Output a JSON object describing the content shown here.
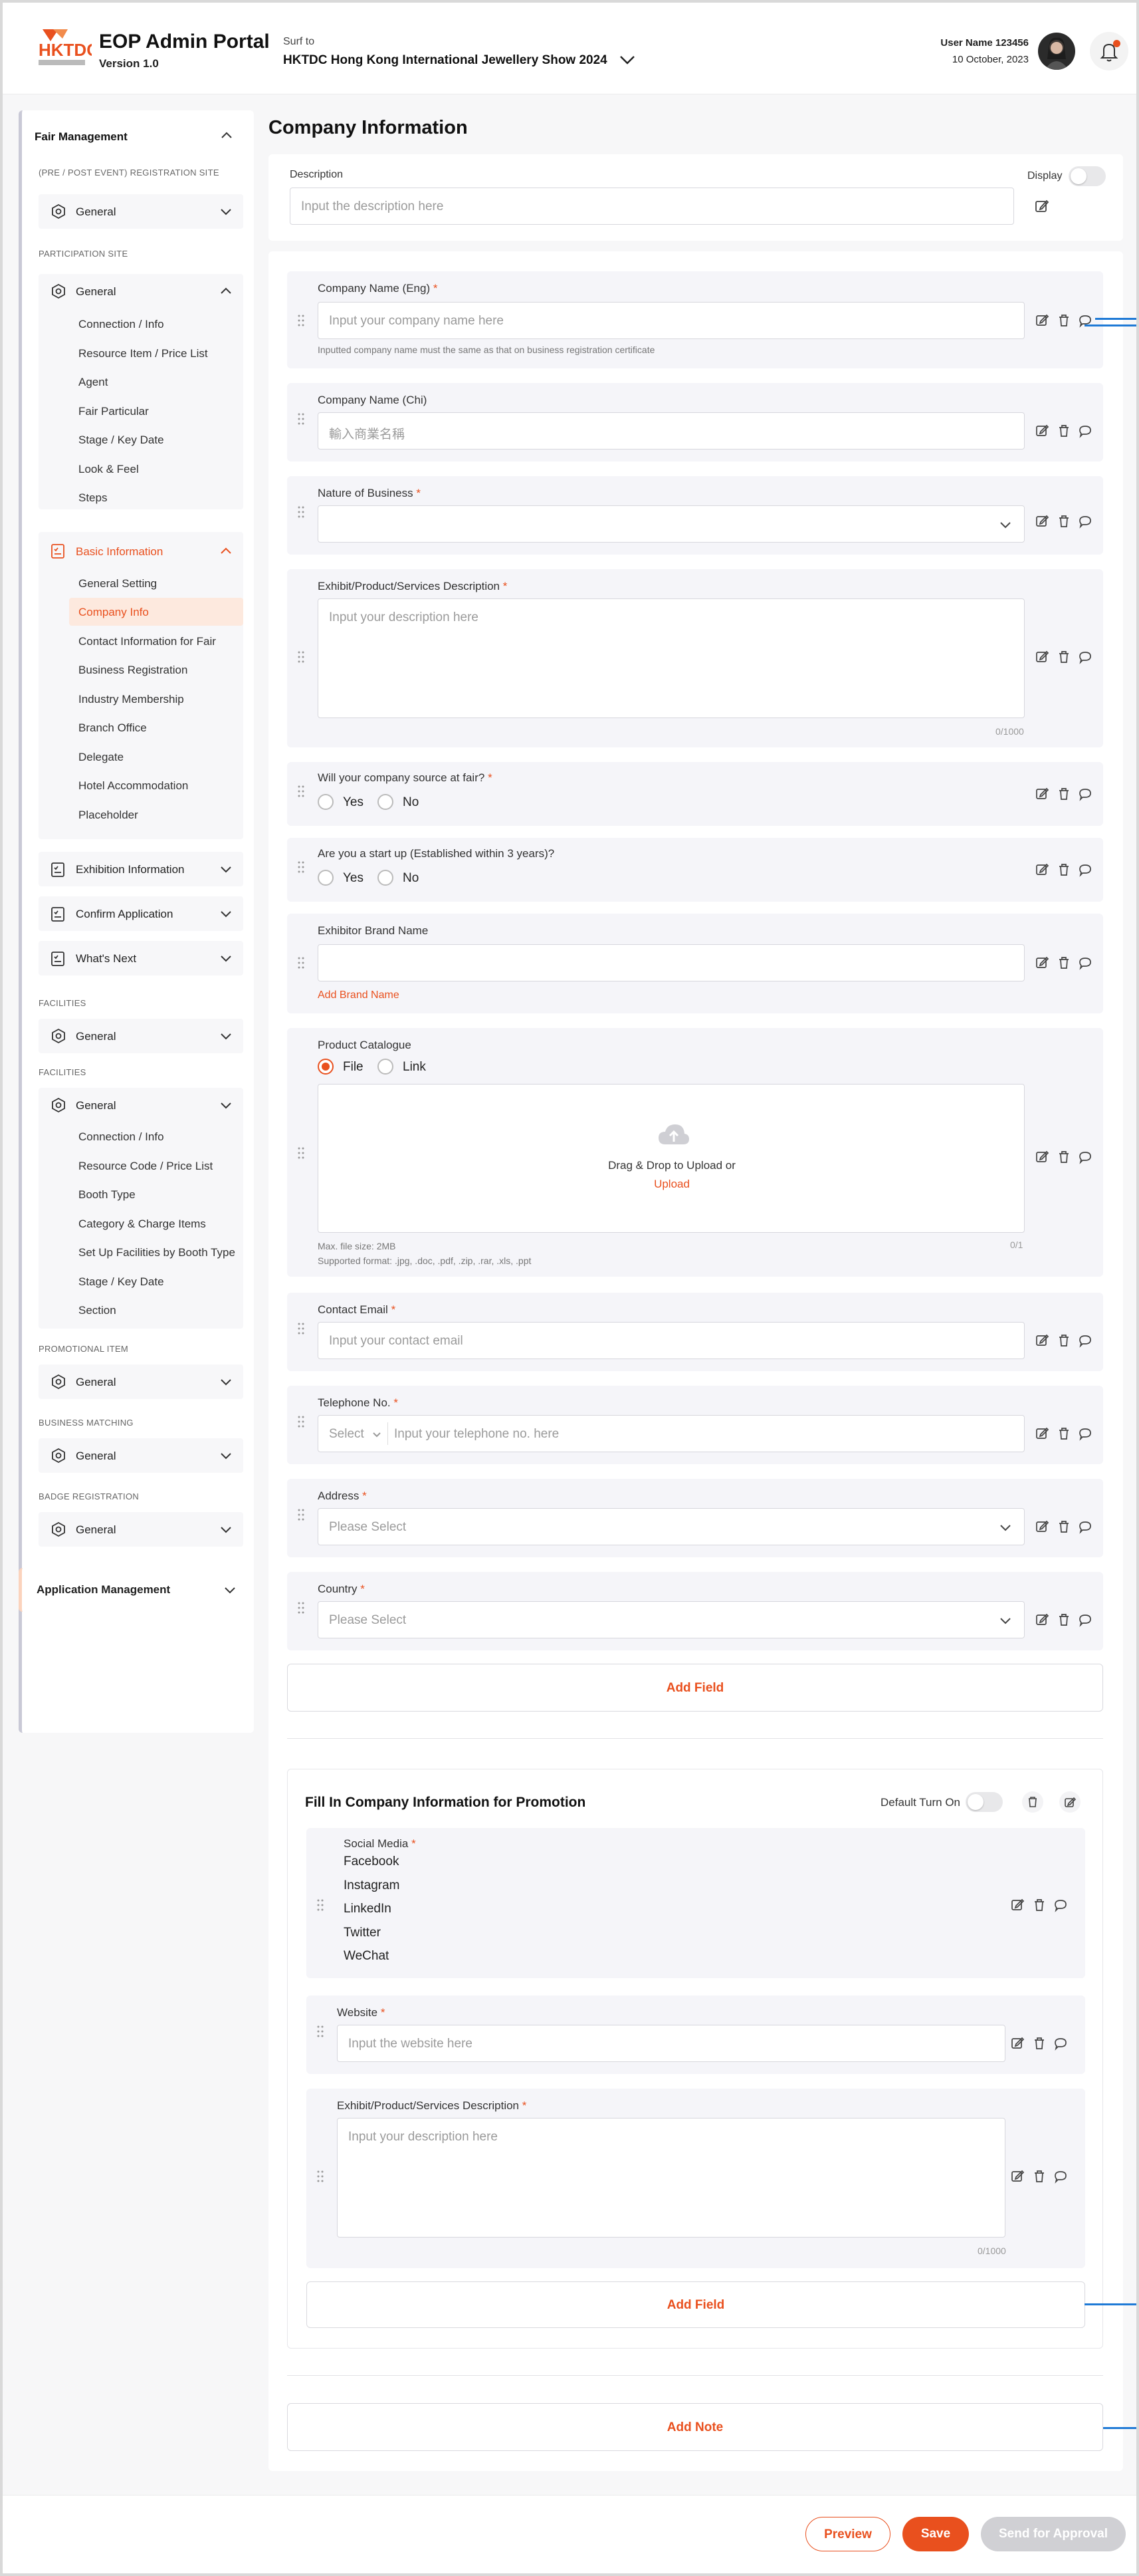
{
  "header": {
    "app_title": "EOP Admin Portal",
    "version": "Version 1.0",
    "logo_text": "HKTDC",
    "surf_label": "Surf to",
    "surf_value": "HKTDC Hong Kong International Jewellery Show 2024",
    "user_name": "User Name 123456",
    "date": "10 October, 2023"
  },
  "sidebar": {
    "fair_management": "Fair Management",
    "cat_pre_post": "(PRE / POST EVENT) REGISTRATION SITE",
    "general": "General",
    "cat_participation": "PARTICIPATION SITE",
    "participation_items": [
      "Connection / Info",
      "Resource Item / Price List",
      "Agent",
      "Fair Particular",
      "Stage / Key Date",
      "Look & Feel",
      "Steps"
    ],
    "basic_information": "Basic Information",
    "basic_items": [
      "General Setting",
      "Company Info",
      "Contact Information for Fair",
      "Business Registration",
      "Industry Membership",
      "Branch Office",
      "Delegate",
      "Hotel Accommodation",
      "Placeholder"
    ],
    "exhibition_information": "Exhibition Information",
    "confirm_application": "Confirm Application",
    "whats_next": "What's Next",
    "cat_facilities": "FACILITIES",
    "facilities_items": [
      "Connection / Info",
      "Resource Code / Price List",
      "Booth Type",
      "Category & Charge Items",
      "Set Up Facilities by Booth Type",
      "Stage / Key Date",
      "Section"
    ],
    "cat_promotional": "PROMOTIONAL ITEM",
    "cat_business": "BUSINESS MATCHING",
    "cat_badge": "BADGE REGISTRATION",
    "application_management": "Application Management"
  },
  "main": {
    "page_title": "Company Information",
    "description_label": "Description",
    "description_placeholder": "Input the description here",
    "display_label": "Display",
    "fields": {
      "company_name_eng": {
        "label": "Company Name (Eng)",
        "placeholder": "Input your company name here",
        "hint": "Inputted company name must the same as that on business registration certificate"
      },
      "company_name_chi": {
        "label": "Company Name (Chi)",
        "placeholder": "輸入商業名稱"
      },
      "nature_of_business": {
        "label": "Nature of Business"
      },
      "exhibit_description": {
        "label": "Exhibit/Product/Services Description",
        "placeholder": "Input your description here",
        "counter": "0/1000"
      },
      "source_at_fair": {
        "label": "Will your company source at fair?",
        "yes": "Yes",
        "no": "No"
      },
      "start_up": {
        "label": "Are you a start up (Established within 3 years)?",
        "yes": "Yes",
        "no": "No"
      },
      "brand_name": {
        "label": "Exhibitor Brand Name",
        "add_link": "Add Brand Name"
      },
      "product_catalogue": {
        "label": "Product Catalogue",
        "file": "File",
        "link": "Link",
        "drop_text": "Drag & Drop to Upload or",
        "upload": "Upload",
        "counter": "0/1",
        "max_size": "Max. file size: 2MB",
        "formats": "Supported format: .jpg, .doc, .pdf, .zip, .rar, .xls, .ppt"
      },
      "contact_email": {
        "label": "Contact Email",
        "placeholder": "Input your contact email"
      },
      "telephone": {
        "label": "Telephone No.",
        "select": "Select",
        "placeholder": "Input your telephone no. here"
      },
      "address": {
        "label": "Address",
        "placeholder": "Please Select"
      },
      "country": {
        "label": "Country",
        "placeholder": "Please Select"
      }
    },
    "add_field": "Add Field",
    "promotion": {
      "title": "Fill In Company Information for Promotion",
      "default_turn_on": "Default Turn On",
      "social_media_label": "Social Media",
      "social_media": [
        "Facebook",
        "Instagram",
        "LinkedIn",
        "Twitter",
        "WeChat"
      ],
      "website_label": "Website",
      "website_placeholder": "Input the website here",
      "description_label": "Exhibit/Product/Services Description",
      "description_placeholder": "Input your description here",
      "counter": "0/1000",
      "add_field": "Add Field"
    },
    "add_note": "Add Note"
  },
  "footer": {
    "preview": "Preview",
    "save": "Save",
    "send": "Send for Approval"
  },
  "colors": {
    "accent": "#e9501e",
    "connector": "#1f7ad6"
  }
}
